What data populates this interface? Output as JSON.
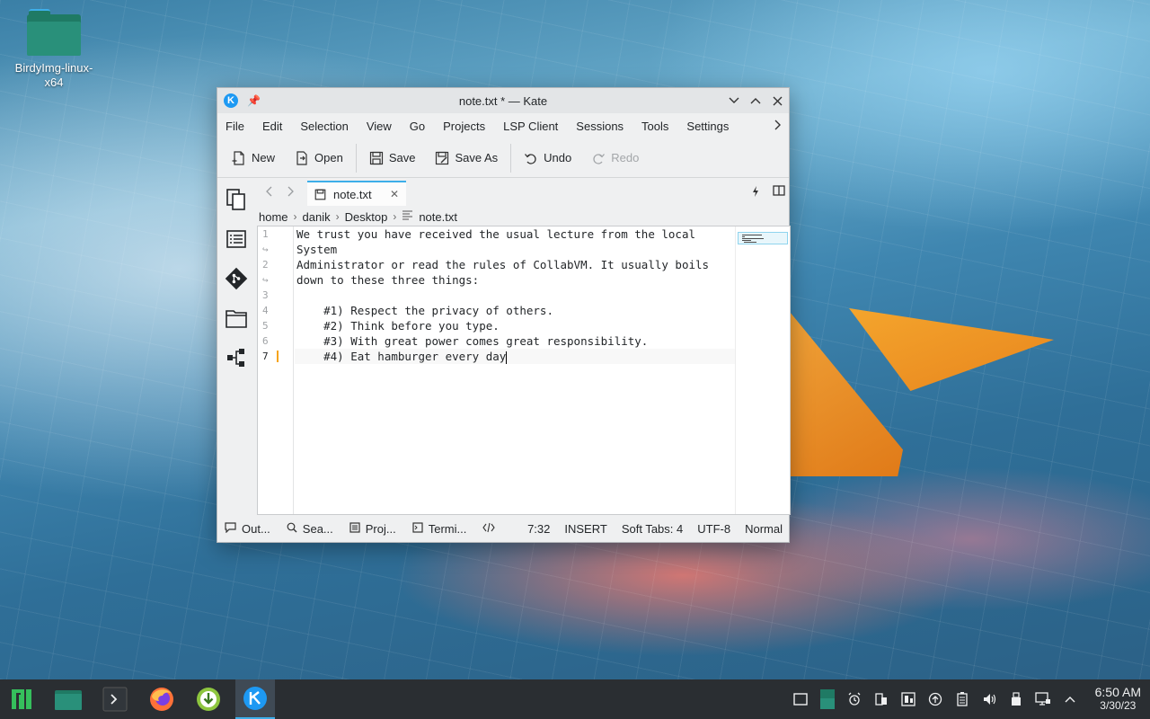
{
  "desktop": {
    "icon_label": "BirdyImg-linux-x64"
  },
  "window": {
    "title": "note.txt * — Kate",
    "menu": [
      "File",
      "Edit",
      "Selection",
      "View",
      "Go",
      "Projects",
      "LSP Client",
      "Sessions",
      "Tools",
      "Settings"
    ],
    "toolbar": {
      "new": "New",
      "open": "Open",
      "save": "Save",
      "save_as": "Save As",
      "undo": "Undo",
      "redo": "Redo"
    },
    "tab_label": "note.txt",
    "breadcrumb": [
      "home",
      "danik",
      "Desktop",
      "note.txt"
    ],
    "editor": {
      "line_numbers": [
        "1",
        "↪",
        "2",
        "↪",
        "3",
        "4",
        "5",
        "6",
        "7"
      ],
      "lines": [
        "We trust you have received the usual lecture from the local",
        "System",
        "Administrator or read the rules of CollabVM. It usually boils",
        "down to these three things:",
        "",
        "    #1) Respect the privacy of others.",
        "    #2) Think before you type.",
        "    #3) With great power comes great responsibility.",
        "    #4) Eat hamburger every day"
      ]
    },
    "statusbar": {
      "output": "Out...",
      "search": "Sea...",
      "projects": "Proj...",
      "terminal": "Termi...",
      "position": "7:32",
      "mode": "INSERT",
      "tabs": "Soft Tabs: 4",
      "encoding": "UTF-8",
      "input_mode": "Normal"
    }
  },
  "taskbar": {
    "time": "6:50 AM",
    "date": "3/30/23"
  },
  "colors": {
    "accent": "#3daee9",
    "taskbar_bg": "#2a2e32",
    "orange": "#f4a52d"
  }
}
